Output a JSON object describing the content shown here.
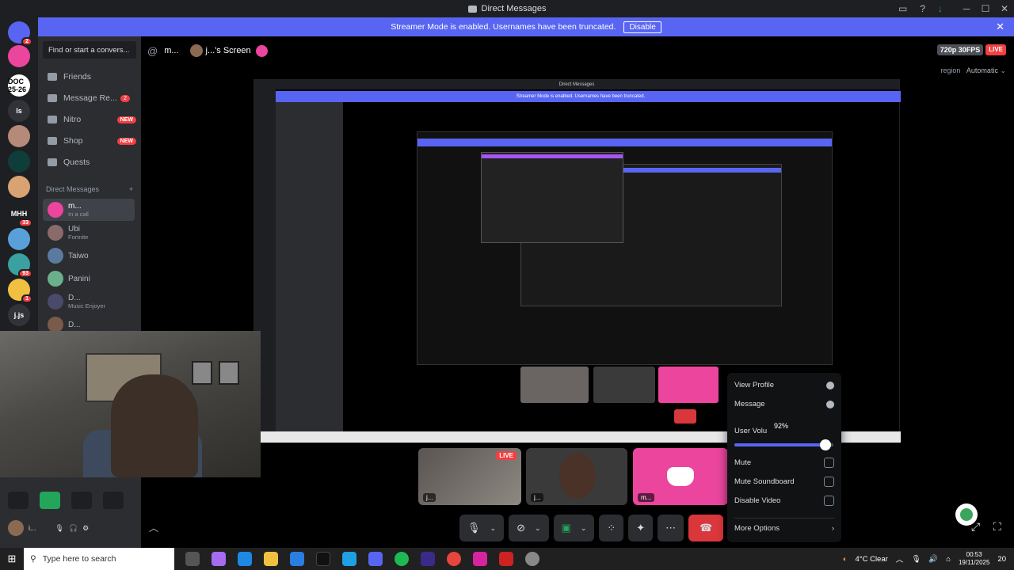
{
  "window": {
    "title": "Direct Messages"
  },
  "banner": {
    "text": "Streamer Mode is enabled. Usernames have been truncated.",
    "disable_label": "Disable"
  },
  "servers": [
    {
      "label": "",
      "color": "#5865f2",
      "badge": "2"
    },
    {
      "label": "",
      "color": "#eb459e",
      "badge": ""
    },
    {
      "label": "DOC 25-26",
      "color": "#ffffff",
      "badge": ""
    },
    {
      "label": "ls",
      "color": "#313338",
      "badge": ""
    },
    {
      "label": "",
      "color": "#b58a78",
      "badge": ""
    },
    {
      "label": "",
      "color": "#0f3d3a",
      "badge": ""
    },
    {
      "label": "",
      "color": "#d8a272",
      "badge": ""
    },
    {
      "label": "MHH",
      "color": "#1e1f22",
      "badge": "33"
    },
    {
      "label": "",
      "color": "#5aa0d8",
      "badge": ""
    },
    {
      "label": "",
      "color": "#3aa0a0",
      "badge": "93"
    },
    {
      "label": "",
      "color": "#f0c040",
      "badge": "1"
    },
    {
      "label": "j.js",
      "color": "#313338",
      "badge": ""
    }
  ],
  "sidebar": {
    "search_placeholder": "Find or start a convers...",
    "nav": [
      {
        "label": "Friends",
        "badge": "",
        "new": ""
      },
      {
        "label": "Message Re...",
        "badge": "2",
        "new": ""
      },
      {
        "label": "Nitro",
        "badge": "",
        "new": "NEW"
      },
      {
        "label": "Shop",
        "badge": "",
        "new": "NEW"
      },
      {
        "label": "Quests",
        "badge": "",
        "new": ""
      }
    ],
    "dm_header": "Direct Messages",
    "dm_add": "+",
    "dms": [
      {
        "name": "m...",
        "sub": "In a call",
        "color": "#eb459e",
        "active": true
      },
      {
        "name": "Ubi",
        "sub": "Fortnite",
        "color": "#8a6a6a",
        "active": false
      },
      {
        "name": "Taiwo",
        "sub": "",
        "color": "#5a7aa0",
        "active": false
      },
      {
        "name": "Panini",
        "sub": "",
        "color": "#6ab08a",
        "active": false
      },
      {
        "name": "D...",
        "sub": "Music Enjoyer",
        "color": "#4a4a6a",
        "active": false
      },
      {
        "name": "D...",
        "sub": "",
        "color": "#7a5a4a",
        "active": false
      }
    ],
    "user": {
      "name": "i...",
      "status": "S..."
    }
  },
  "header": {
    "at": "@",
    "name": "m...",
    "screen": "j...'s Screen",
    "quality": "720p 30FPS",
    "live": "LIVE",
    "region": "region",
    "region_value": "Automatic"
  },
  "tiles": {
    "live": "LIVE",
    "label1": "j...",
    "label2": "j...",
    "label3": "m..."
  },
  "popup": {
    "view_profile": "View Profile",
    "message": "Message",
    "user_volume": "User Volu",
    "volume_pct": "92%",
    "volume_value": 0.92,
    "mute": "Mute",
    "mute_soundboard": "Mute Soundboard",
    "disable_video": "Disable Video",
    "more_options": "More Options"
  },
  "taskbar": {
    "search_placeholder": "Type here to search",
    "weather": "4°C  Clear",
    "time": "00:53",
    "date": "19/11/2025",
    "notif": "20"
  }
}
